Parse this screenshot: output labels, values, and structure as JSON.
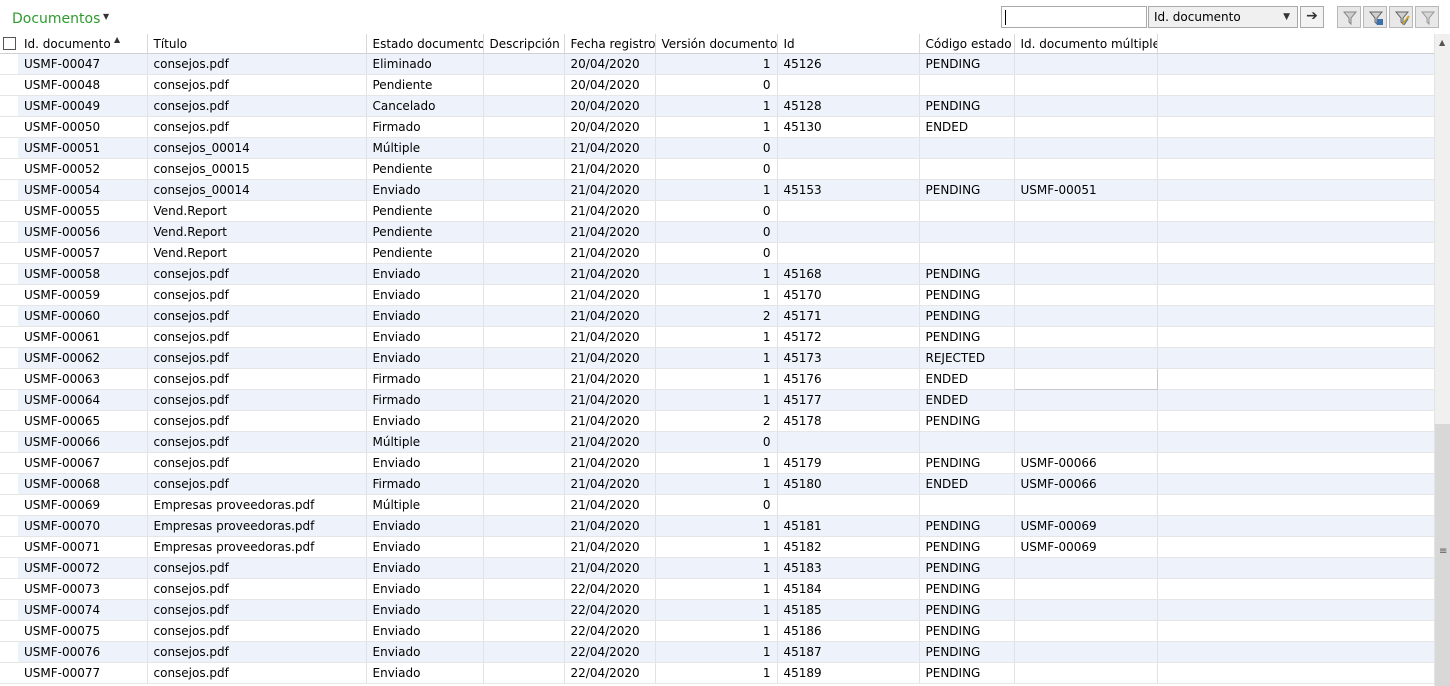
{
  "header": {
    "title": "Documentos",
    "title_menu_icon": "caret-down-icon",
    "search": {
      "value": "",
      "placeholder": ""
    },
    "field_select": {
      "selected": "Id. documento"
    },
    "go_icon": "arrow-right-icon",
    "filter_icons": [
      "filter-icon",
      "filter-grid-icon",
      "filter-edit-icon",
      "filter-clear-icon"
    ]
  },
  "grid": {
    "columns": [
      "Id. documento",
      "Título",
      "Estado documento",
      "Descripción",
      "Fecha registro",
      "Versión documento",
      "Id",
      "Código estado",
      "Id. documento múltiple"
    ],
    "sort": {
      "column": "Id. documento",
      "direction": "ascending"
    },
    "rows": [
      [
        "USMF-00047",
        "consejos.pdf",
        "Eliminado",
        "",
        "20/04/2020",
        "1",
        "45126",
        "PENDING",
        ""
      ],
      [
        "USMF-00048",
        "consejos.pdf",
        "Pendiente",
        "",
        "20/04/2020",
        "0",
        "",
        "",
        ""
      ],
      [
        "USMF-00049",
        "consejos.pdf",
        "Cancelado",
        "",
        "20/04/2020",
        "1",
        "45128",
        "PENDING",
        ""
      ],
      [
        "USMF-00050",
        "consejos.pdf",
        "Firmado",
        "",
        "20/04/2020",
        "1",
        "45130",
        "ENDED",
        ""
      ],
      [
        "USMF-00051",
        "consejos_00014",
        "Múltiple",
        "",
        "21/04/2020",
        "0",
        "",
        "",
        ""
      ],
      [
        "USMF-00052",
        "consejos_00015",
        "Pendiente",
        "",
        "21/04/2020",
        "0",
        "",
        "",
        ""
      ],
      [
        "USMF-00054",
        "consejos_00014",
        "Enviado",
        "",
        "21/04/2020",
        "1",
        "45153",
        "PENDING",
        "USMF-00051"
      ],
      [
        "USMF-00055",
        "Vend.Report",
        "Pendiente",
        "",
        "21/04/2020",
        "0",
        "",
        "",
        ""
      ],
      [
        "USMF-00056",
        "Vend.Report",
        "Pendiente",
        "",
        "21/04/2020",
        "0",
        "",
        "",
        ""
      ],
      [
        "USMF-00057",
        "Vend.Report",
        "Pendiente",
        "",
        "21/04/2020",
        "0",
        "",
        "",
        ""
      ],
      [
        "USMF-00058",
        "consejos.pdf",
        "Enviado",
        "",
        "21/04/2020",
        "1",
        "45168",
        "PENDING",
        ""
      ],
      [
        "USMF-00059",
        "consejos.pdf",
        "Enviado",
        "",
        "21/04/2020",
        "1",
        "45170",
        "PENDING",
        ""
      ],
      [
        "USMF-00060",
        "consejos.pdf",
        "Enviado",
        "",
        "21/04/2020",
        "2",
        "45171",
        "PENDING",
        ""
      ],
      [
        "USMF-00061",
        "consejos.pdf",
        "Enviado",
        "",
        "21/04/2020",
        "1",
        "45172",
        "PENDING",
        ""
      ],
      [
        "USMF-00062",
        "consejos.pdf",
        "Enviado",
        "",
        "21/04/2020",
        "1",
        "45173",
        "REJECTED",
        ""
      ],
      [
        "USMF-00063",
        "consejos.pdf",
        "Firmado",
        "",
        "21/04/2020",
        "1",
        "45176",
        "ENDED",
        ""
      ],
      [
        "USMF-00064",
        "consejos.pdf",
        "Firmado",
        "",
        "21/04/2020",
        "1",
        "45177",
        "ENDED",
        ""
      ],
      [
        "USMF-00065",
        "consejos.pdf",
        "Enviado",
        "",
        "21/04/2020",
        "2",
        "45178",
        "PENDING",
        ""
      ],
      [
        "USMF-00066",
        "consejos.pdf",
        "Múltiple",
        "",
        "21/04/2020",
        "0",
        "",
        "",
        ""
      ],
      [
        "USMF-00067",
        "consejos.pdf",
        "Enviado",
        "",
        "21/04/2020",
        "1",
        "45179",
        "PENDING",
        "USMF-00066"
      ],
      [
        "USMF-00068",
        "consejos.pdf",
        "Firmado",
        "",
        "21/04/2020",
        "1",
        "45180",
        "ENDED",
        "USMF-00066"
      ],
      [
        "USMF-00069",
        "Empresas proveedoras.pdf",
        "Múltiple",
        "",
        "21/04/2020",
        "0",
        "",
        "",
        ""
      ],
      [
        "USMF-00070",
        "Empresas proveedoras.pdf",
        "Enviado",
        "",
        "21/04/2020",
        "1",
        "45181",
        "PENDING",
        "USMF-00069"
      ],
      [
        "USMF-00071",
        "Empresas proveedoras.pdf",
        "Enviado",
        "",
        "21/04/2020",
        "1",
        "45182",
        "PENDING",
        "USMF-00069"
      ],
      [
        "USMF-00072",
        "consejos.pdf",
        "Enviado",
        "",
        "21/04/2020",
        "1",
        "45183",
        "PENDING",
        ""
      ],
      [
        "USMF-00073",
        "consejos.pdf",
        "Enviado",
        "",
        "22/04/2020",
        "1",
        "45184",
        "PENDING",
        ""
      ],
      [
        "USMF-00074",
        "consejos.pdf",
        "Enviado",
        "",
        "22/04/2020",
        "1",
        "45185",
        "PENDING",
        ""
      ],
      [
        "USMF-00075",
        "consejos.pdf",
        "Enviado",
        "",
        "22/04/2020",
        "1",
        "45186",
        "PENDING",
        ""
      ],
      [
        "USMF-00076",
        "consejos.pdf",
        "Enviado",
        "",
        "22/04/2020",
        "1",
        "45187",
        "PENDING",
        ""
      ],
      [
        "USMF-00077",
        "consejos.pdf",
        "Enviado",
        "",
        "22/04/2020",
        "1",
        "45189",
        "PENDING",
        ""
      ]
    ],
    "focused_row": "USMF-00063"
  },
  "scrollbar": {
    "up_icon": "scroll-up-icon",
    "grip_icon": "scroll-grip-icon"
  }
}
